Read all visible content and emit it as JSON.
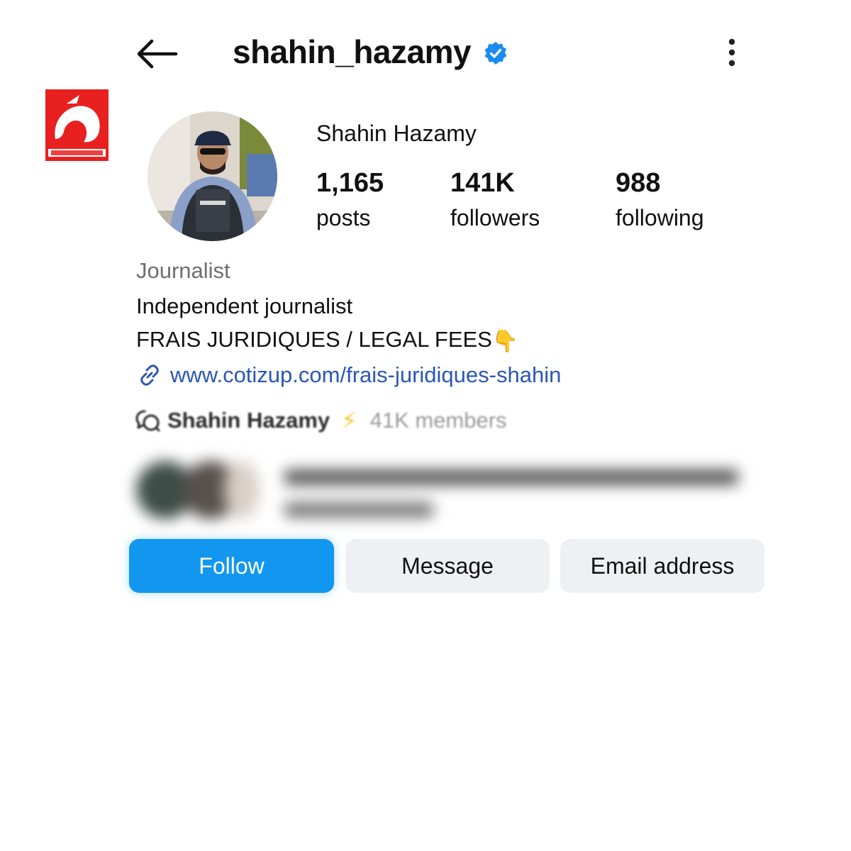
{
  "header": {
    "username": "shahin_hazamy",
    "verified": true,
    "back_icon": "arrow-left-icon",
    "menu_icon": "kebab-menu-icon"
  },
  "profile": {
    "display_name": "Shahin Hazamy",
    "stats": [
      {
        "value": "1,165",
        "label": "posts"
      },
      {
        "value": "141K",
        "label": "followers"
      },
      {
        "value": "988",
        "label": "following"
      }
    ]
  },
  "bio": {
    "category": "Journalist",
    "line1": "Independent journalist",
    "line2": "FRAIS JURIDIQUES / LEGAL FEES",
    "line2_emoji": "👇",
    "link": "www.cotizup.com/frais-juridiques-shahin"
  },
  "channel": {
    "name": "Shahin Hazamy",
    "bolt": "⚡",
    "members": "41K members"
  },
  "buttons": {
    "follow": "Follow",
    "message": "Message",
    "email": "Email address"
  },
  "colors": {
    "accent": "#1297f0",
    "verified": "#1a8cf0",
    "link": "#2a56b8",
    "secondary_button": "#eef0f3",
    "logo_red": "#e8201f"
  }
}
